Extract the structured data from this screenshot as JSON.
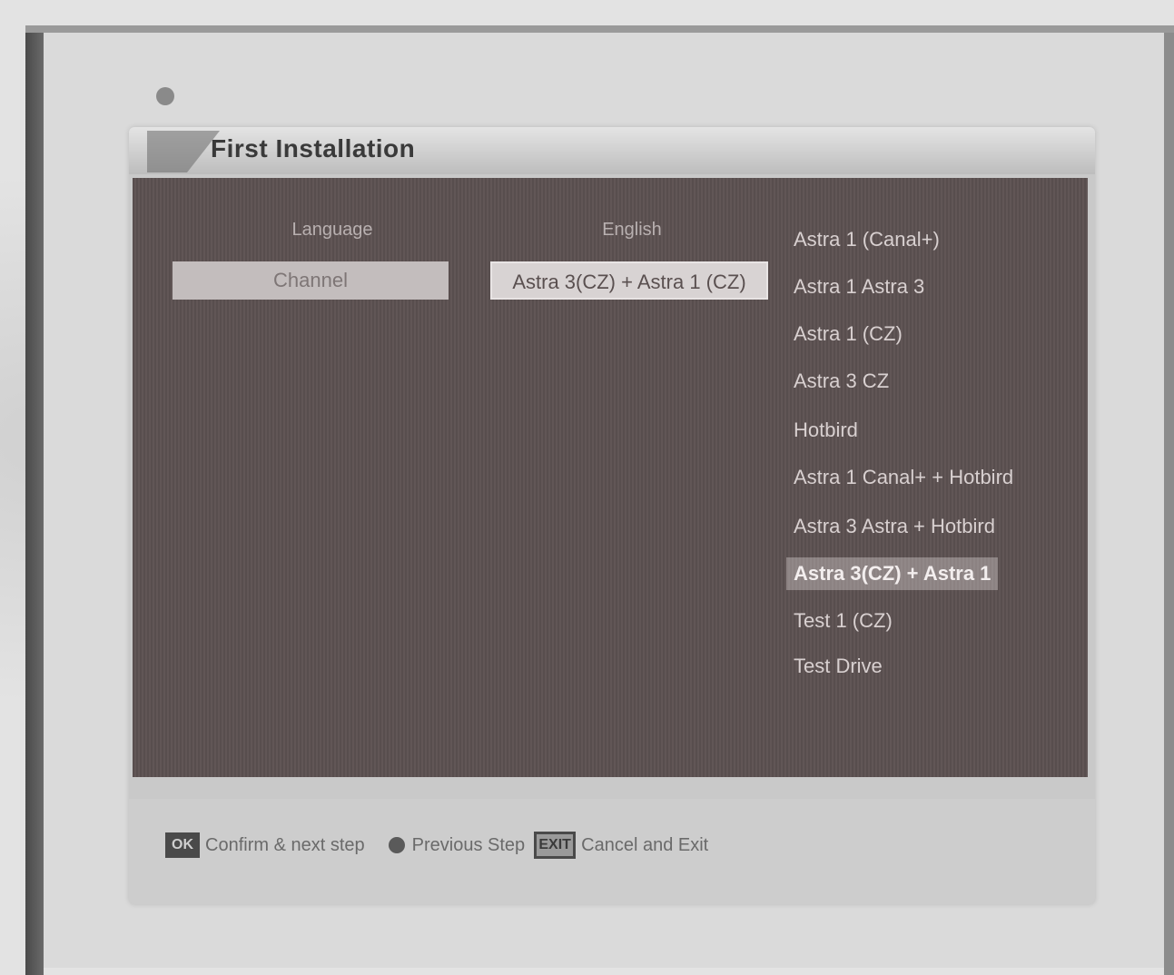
{
  "dialog": {
    "title": "First Installation"
  },
  "columns": {
    "language_header": "Language",
    "english_header": "English"
  },
  "fields": {
    "language_value": "Channel",
    "satellite_value": "Astra 3(CZ) + Astra 1 (CZ)"
  },
  "satellite_list": {
    "items": [
      {
        "label": "Astra 1 (Canal+)"
      },
      {
        "label": "Astra 1 Astra 3"
      },
      {
        "label": "Astra 1 (CZ)"
      },
      {
        "label": "Astra 3 CZ"
      },
      {
        "label": "Hotbird"
      },
      {
        "label": "Astra 1 Canal+ + Hotbird"
      },
      {
        "label": "Astra 3 Astra + Hotbird"
      },
      {
        "label": "Astra 3(CZ) + Astra 1"
      },
      {
        "label": "Test 1 (CZ)"
      },
      {
        "label": "Test Drive"
      }
    ],
    "selected_index": 7
  },
  "footer": {
    "ok_key": "OK",
    "confirm_text": "Confirm & next step",
    "previous_text": "Previous Step",
    "exit_key": "EXIT",
    "cancel_text": "Cancel and Exit"
  },
  "colors": {
    "content_bg": "#5c5151",
    "selected_field_bg": "#d8d3d3",
    "footer_bg": "#cdcdcd"
  }
}
